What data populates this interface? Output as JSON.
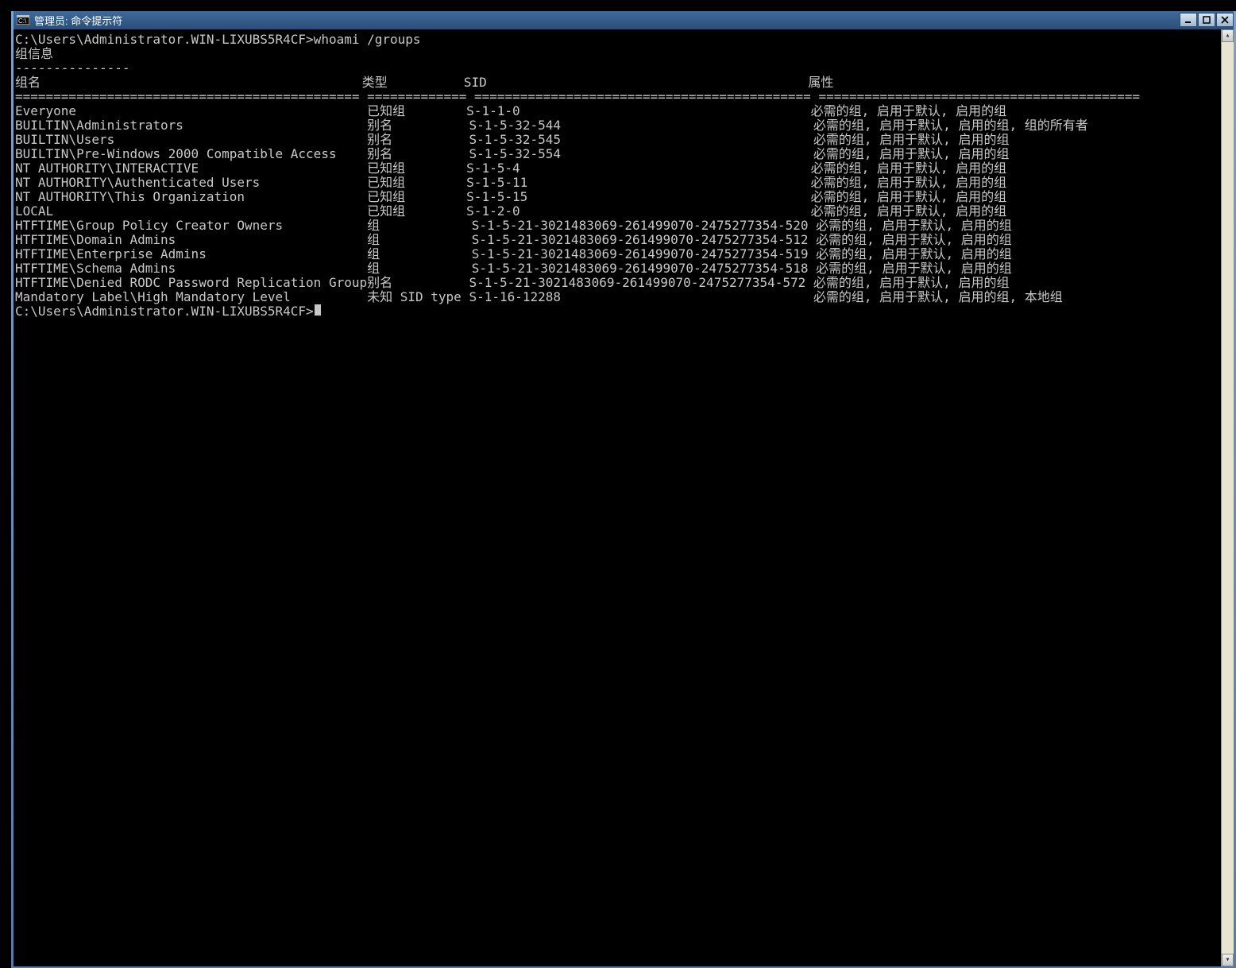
{
  "window": {
    "title": "管理员: 命令提示符"
  },
  "prompt_path": "C:\\Users\\Administrator.WIN-LIXUBS5R4CF>",
  "command": "whoami /groups",
  "section_header": "组信息",
  "section_underline": "---------------",
  "columns": {
    "name": "组名",
    "type": "类型",
    "sid": "SID",
    "attrs": "属性"
  },
  "divider": {
    "name": "============================================= ",
    "type": "============= ",
    "sid": "============================================ ",
    "attrs": "=========================================="
  },
  "rows": [
    {
      "name": "Everyone",
      "type": "已知组",
      "sid": "S-1-1-0",
      "attrs": "必需的组, 启用于默认, 启用的组"
    },
    {
      "name": "BUILTIN\\Administrators",
      "type": "别名",
      "sid": "S-1-5-32-544",
      "attrs": "必需的组, 启用于默认, 启用的组, 组的所有者"
    },
    {
      "name": "BUILTIN\\Users",
      "type": "别名",
      "sid": "S-1-5-32-545",
      "attrs": "必需的组, 启用于默认, 启用的组"
    },
    {
      "name": "BUILTIN\\Pre-Windows 2000 Compatible Access",
      "type": "别名",
      "sid": "S-1-5-32-554",
      "attrs": "必需的组, 启用于默认, 启用的组"
    },
    {
      "name": "NT AUTHORITY\\INTERACTIVE",
      "type": "已知组",
      "sid": "S-1-5-4",
      "attrs": "必需的组, 启用于默认, 启用的组"
    },
    {
      "name": "NT AUTHORITY\\Authenticated Users",
      "type": "已知组",
      "sid": "S-1-5-11",
      "attrs": "必需的组, 启用于默认, 启用的组"
    },
    {
      "name": "NT AUTHORITY\\This Organization",
      "type": "已知组",
      "sid": "S-1-5-15",
      "attrs": "必需的组, 启用于默认, 启用的组"
    },
    {
      "name": "LOCAL",
      "type": "已知组",
      "sid": "S-1-2-0",
      "attrs": "必需的组, 启用于默认, 启用的组"
    },
    {
      "name": "HTFTIME\\Group Policy Creator Owners",
      "type": "组",
      "sid": "S-1-5-21-3021483069-261499070-2475277354-520",
      "attrs": "必需的组, 启用于默认, 启用的组"
    },
    {
      "name": "HTFTIME\\Domain Admins",
      "type": "组",
      "sid": "S-1-5-21-3021483069-261499070-2475277354-512",
      "attrs": "必需的组, 启用于默认, 启用的组"
    },
    {
      "name": "HTFTIME\\Enterprise Admins",
      "type": "组",
      "sid": "S-1-5-21-3021483069-261499070-2475277354-519",
      "attrs": "必需的组, 启用于默认, 启用的组"
    },
    {
      "name": "HTFTIME\\Schema Admins",
      "type": "组",
      "sid": "S-1-5-21-3021483069-261499070-2475277354-518",
      "attrs": "必需的组, 启用于默认, 启用的组"
    },
    {
      "name": "HTFTIME\\Denied RODC Password Replication Group",
      "type": "别名",
      "sid": "S-1-5-21-3021483069-261499070-2475277354-572",
      "attrs": "必需的组, 启用于默认, 启用的组"
    },
    {
      "name": "Mandatory Label\\High Mandatory Level",
      "type": "未知 SID type",
      "sid": "S-1-16-12288",
      "attrs": "必需的组, 启用于默认, 启用的组, 本地组"
    }
  ],
  "col_widths": {
    "name": 46,
    "type": 14,
    "sid": 45
  }
}
